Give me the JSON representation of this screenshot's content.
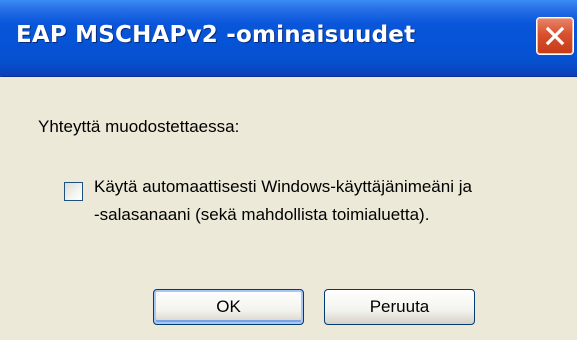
{
  "window": {
    "title": "EAP MSCHAPv2 -ominaisuudet"
  },
  "dialog": {
    "group_label": "Yhteyttä muodostettaessa:",
    "checkbox": {
      "checked": false,
      "label_line1": "Käytä automaattisesti Windows-käyttäjänimeäni ja",
      "label_line2": "-salasanaani (sekä mahdollista toimialuetta)."
    },
    "buttons": {
      "ok_label": "OK",
      "cancel_label": "Peruuta"
    }
  },
  "icons": {
    "close": "close-icon"
  },
  "colors": {
    "titlebar": "#0553d6",
    "body": "#ece9d8",
    "close_button": "#d8502e"
  }
}
